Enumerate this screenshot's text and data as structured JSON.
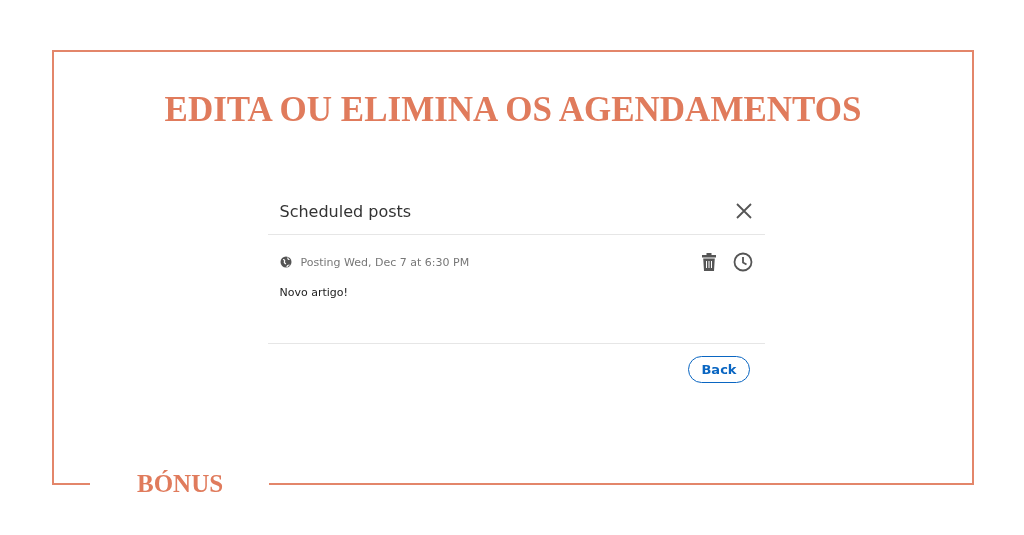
{
  "heading": "EDITA OU ELIMINA OS AGENDAMENTOS",
  "dialog": {
    "title": "Scheduled posts",
    "posts": [
      {
        "schedule": "Posting Wed, Dec 7 at 6:30 PM",
        "text": "Novo artigo!"
      }
    ],
    "buttons": [
      "Back"
    ]
  },
  "footer_label": "BÓNUS"
}
